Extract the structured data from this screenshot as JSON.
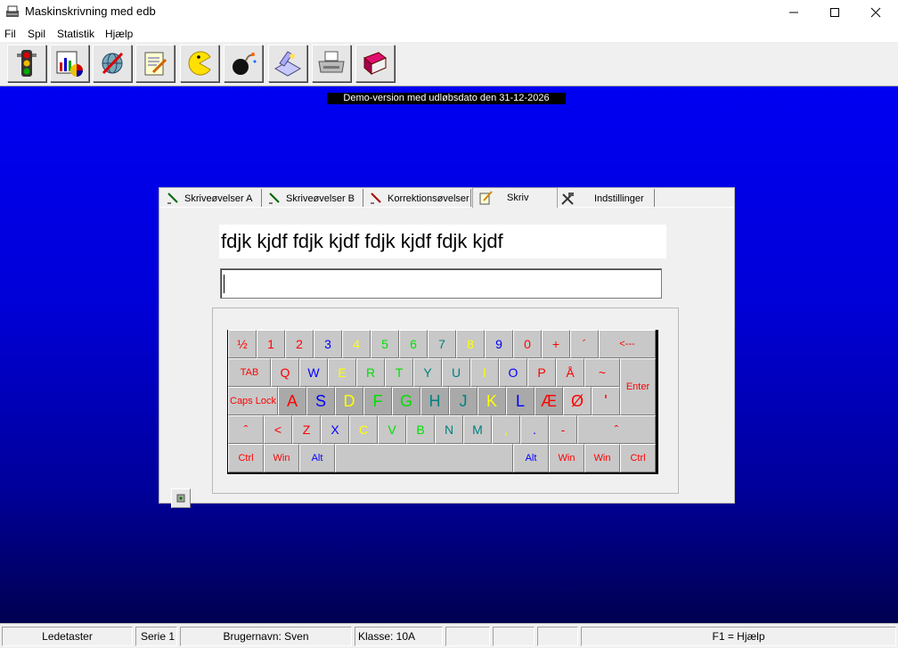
{
  "window": {
    "title": "Maskinskrivning med edb"
  },
  "menu": {
    "items": [
      "Fil",
      "Spil",
      "Statistik",
      "Hjælp"
    ]
  },
  "toolbar": {
    "buttons": [
      "traffic-light-icon",
      "statistics-chart-icon",
      "globe-icon",
      "document-edit-icon",
      "pacman-icon",
      "bomb-icon",
      "scanner-icon",
      "printer-icon",
      "book-icon"
    ]
  },
  "banner": {
    "text": "Demo-version med udløbsdato den 31-12-2026"
  },
  "tabs": [
    {
      "label": "Skriveøvelser A",
      "icon": "pen-icon"
    },
    {
      "label": "Skriveøvelser B",
      "icon": "pen-icon"
    },
    {
      "label": "Korrektionsøvelser",
      "icon": "correction-pen-icon"
    },
    {
      "label": "Skriv",
      "icon": "notepad-icon"
    },
    {
      "label": "Indstillinger",
      "icon": "tools-icon"
    }
  ],
  "exercise": {
    "prompt_text": "fdjk kjdf fdjk kjdf fdjk kjdf fdjk kjdf",
    "typed_text": ""
  },
  "colors": {
    "red": "#ff0000",
    "blue": "#0000ff",
    "yellow": "#ffff00",
    "green": "#00e000",
    "teal": "#008080",
    "black": "#000000"
  },
  "keyboard": {
    "rows": [
      [
        {
          "label": "½",
          "color": "red"
        },
        {
          "label": "1",
          "color": "red"
        },
        {
          "label": "2",
          "color": "red"
        },
        {
          "label": "3",
          "color": "blue"
        },
        {
          "label": "4",
          "color": "yellow"
        },
        {
          "label": "5",
          "color": "green"
        },
        {
          "label": "6",
          "color": "green"
        },
        {
          "label": "7",
          "color": "teal"
        },
        {
          "label": "8",
          "color": "yellow"
        },
        {
          "label": "9",
          "color": "blue"
        },
        {
          "label": "0",
          "color": "red"
        },
        {
          "label": "+",
          "color": "red"
        },
        {
          "label": "´",
          "color": "red"
        },
        {
          "label": "<---",
          "color": "red"
        }
      ],
      [
        {
          "label": "TAB",
          "color": "red"
        },
        {
          "label": "Q",
          "color": "red"
        },
        {
          "label": "W",
          "color": "blue"
        },
        {
          "label": "E",
          "color": "yellow"
        },
        {
          "label": "R",
          "color": "green"
        },
        {
          "label": "T",
          "color": "green"
        },
        {
          "label": "Y",
          "color": "teal"
        },
        {
          "label": "U",
          "color": "teal"
        },
        {
          "label": "I",
          "color": "yellow"
        },
        {
          "label": "O",
          "color": "blue"
        },
        {
          "label": "P",
          "color": "red"
        },
        {
          "label": "Å",
          "color": "red"
        },
        {
          "label": "~",
          "color": "red"
        },
        {
          "label": "Enter",
          "color": "red"
        }
      ],
      [
        {
          "label": "Caps Lock",
          "color": "red"
        },
        {
          "label": "A",
          "color": "red"
        },
        {
          "label": "S",
          "color": "blue"
        },
        {
          "label": "D",
          "color": "yellow"
        },
        {
          "label": "F",
          "color": "green"
        },
        {
          "label": "G",
          "color": "green"
        },
        {
          "label": "H",
          "color": "teal"
        },
        {
          "label": "J",
          "color": "teal"
        },
        {
          "label": "K",
          "color": "yellow"
        },
        {
          "label": "L",
          "color": "blue"
        },
        {
          "label": "Æ",
          "color": "red"
        },
        {
          "label": "Ø",
          "color": "red"
        },
        {
          "label": "'",
          "color": "red"
        }
      ],
      [
        {
          "label": "ˆ",
          "color": "red"
        },
        {
          "label": "<",
          "color": "red"
        },
        {
          "label": "Z",
          "color": "red"
        },
        {
          "label": "X",
          "color": "blue"
        },
        {
          "label": "C",
          "color": "yellow"
        },
        {
          "label": "V",
          "color": "green"
        },
        {
          "label": "B",
          "color": "green"
        },
        {
          "label": "N",
          "color": "teal"
        },
        {
          "label": "M",
          "color": "teal"
        },
        {
          "label": ",",
          "color": "yellow"
        },
        {
          "label": ".",
          "color": "blue"
        },
        {
          "label": "-",
          "color": "red"
        },
        {
          "label": "ˆ",
          "color": "red"
        }
      ],
      [
        {
          "label": "Ctrl",
          "color": "red"
        },
        {
          "label": "Win",
          "color": "red"
        },
        {
          "label": "Alt",
          "color": "blue"
        },
        {
          "label": "",
          "color": "black"
        },
        {
          "label": "Alt",
          "color": "blue"
        },
        {
          "label": "Win",
          "color": "red"
        },
        {
          "label": "Win",
          "color": "red"
        },
        {
          "label": "Ctrl",
          "color": "red"
        }
      ]
    ]
  },
  "statusbar": {
    "cells": [
      "Ledetaster",
      "Serie 1",
      "Brugernavn: Sven",
      "Klasse: 10A",
      "",
      "",
      "",
      "F1 = Hjælp"
    ]
  }
}
